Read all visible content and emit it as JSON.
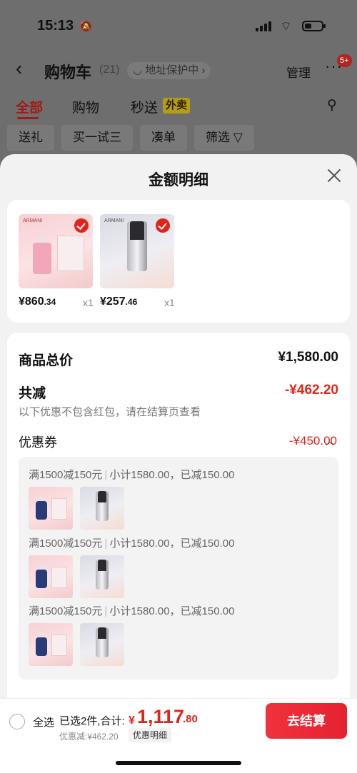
{
  "status_bar": {
    "time": "15:13"
  },
  "nav": {
    "back_icon": "back-arrow-icon",
    "title": "购物车",
    "count": "(21)",
    "address_protect": "地址保护中",
    "manage": "管理",
    "more_badge": "5+"
  },
  "tabs": [
    {
      "label": "全部",
      "active": true
    },
    {
      "label": "购物"
    },
    {
      "label": "秒送"
    }
  ],
  "tab_tag": "外卖",
  "filters": [
    "送礼",
    "买一试三",
    "凑单",
    "筛选"
  ],
  "sheet": {
    "title": "金额明细",
    "products": [
      {
        "price_int": "¥860",
        "price_dec": ".34",
        "qty": "x1",
        "checked": true
      },
      {
        "price_int": "¥257",
        "price_dec": ".46",
        "qty": "x1",
        "checked": true
      }
    ],
    "summary": {
      "total_label": "商品总价",
      "total_value": "¥1,580.00",
      "discount_label": "共减",
      "discount_value": "-¥462.20",
      "discount_note": "以下优惠不包含红包，请在结算页查看",
      "coupon_label": "优惠券",
      "coupon_value": "-¥450.00"
    },
    "coupon_groups": [
      {
        "rule": "满1500减150元",
        "detail": "小计1580.00，已减150.00"
      },
      {
        "rule": "满1500减150元",
        "detail": "小计1580.00，已减150.00"
      },
      {
        "rule": "满1500减150元",
        "detail": "小计1580.00，已减150.00"
      }
    ]
  },
  "bottom_bar": {
    "select_all": "全选",
    "selected_text": "已选2件,合计:",
    "total_symbol": "¥",
    "total_int": "1,117",
    "total_dec": ".80",
    "discount_text": "优惠减:¥462.20",
    "detail_link": "优惠明细",
    "checkout": "去结算"
  },
  "colors": {
    "accent_red": "#e2231a",
    "tag_yellow": "#f6d51d"
  }
}
